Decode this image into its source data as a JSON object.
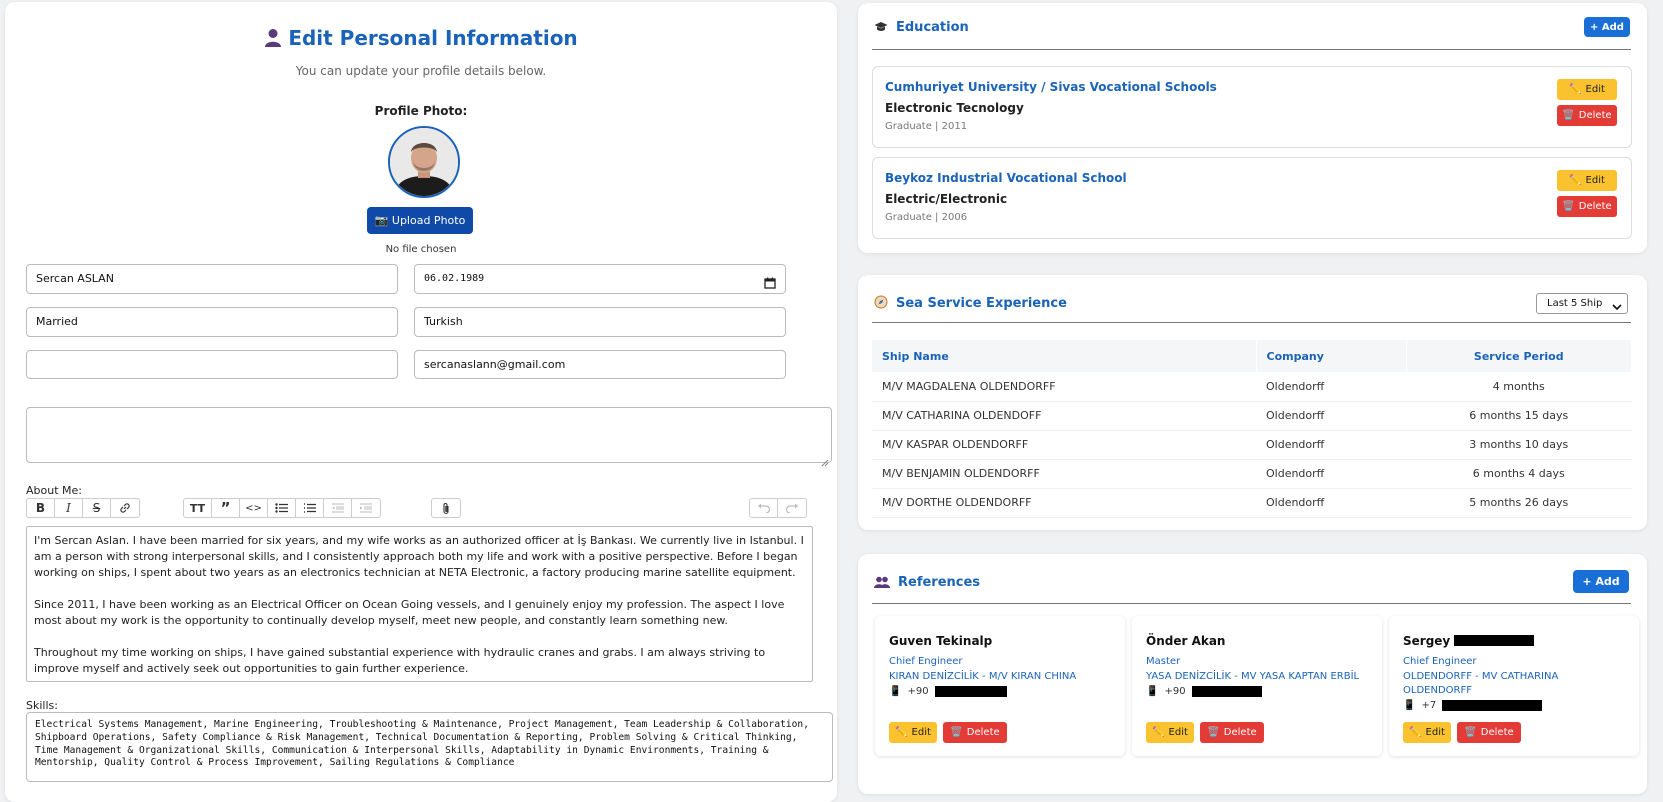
{
  "profile": {
    "title": "Edit Personal Information",
    "subtitle": "You can update your profile details below.",
    "photo_label": "Profile Photo:",
    "upload_label": "Upload Photo",
    "no_file": "No file chosen",
    "full_name": "Sercan ASLAN",
    "birth_date": "06.02.1989",
    "marital_status": "Married",
    "nationality": "Turkish",
    "phone": "",
    "email": "sercanaslann@gmail.com",
    "address": "",
    "about_label": "About Me:",
    "about_paragraphs": [
      "I'm Sercan Aslan. I have been married for six years, and my wife works as an authorized officer at İş Bankası. We currently live in Istanbul. I am a person with strong interpersonal skills, and I consistently approach both my life and work with a positive perspective. Before I began working on ships, I spent about two years as an electronics technician at NETA Electronic, a factory producing marine satellite equipment.",
      "Since 2011, I have been working as an Electrical Officer on Ocean Going vessels, and I genuinely enjoy my profession. The aspect I love most about my work is the opportunity to continually develop myself, meet new people, and constantly learn something new.",
      "Throughout my time working on ships, I have gained substantial experience with hydraulic cranes and grabs. I am always striving to improve myself and actively seek out opportunities to gain further experience."
    ],
    "skills_label": "Skills:",
    "skills": "Electrical Systems Management, Marine Engineering, Troubleshooting & Maintenance, Project Management, Team Leadership & Collaboration, Shipboard Operations, Safety Compliance & Risk Management, Technical Documentation & Reporting, Problem Solving & Critical Thinking, Time Management & Organizational Skills, Communication & Interpersonal Skills, Adaptability in Dynamic Environments, Training & Mentorship, Quality Control & Process Improvement, Sailing Regulations & Compliance"
  },
  "education": {
    "title": "Education",
    "add_label": "+ Add",
    "edit_label": "Edit",
    "delete_label": "Delete",
    "items": [
      {
        "school": "Cumhuriyet University / Sivas Vocational Schools",
        "department": "Electronic Tecnology",
        "meta": "Graduate | 2011"
      },
      {
        "school": "Beykoz Industrial Vocational School",
        "department": "Electric/Electronic",
        "meta": "Graduate | 2006"
      }
    ]
  },
  "sea_service": {
    "title": "Sea Service Experience",
    "filter_value": "Last 5 Ship",
    "columns": [
      "Ship Name",
      "Company",
      "Service Period"
    ],
    "rows": [
      {
        "ship": "M/V MAGDALENA OLDENDORFF",
        "company": "Oldendorff",
        "period": "4 months"
      },
      {
        "ship": "M/V CATHARINA OLDENDOFF",
        "company": "Oldendorff",
        "period": "6 months 15 days"
      },
      {
        "ship": "M/V KASPAR OLDENDORFF",
        "company": "Oldendorff",
        "period": "3 months 10 days"
      },
      {
        "ship": "M/V BENJAMIN OLDENDORFF",
        "company": "Oldendorff",
        "period": "6 months 4 days"
      },
      {
        "ship": "M/V DORTHE OLDENDORFF",
        "company": "Oldendorff",
        "period": "5 months 26 days"
      }
    ]
  },
  "references": {
    "title": "References",
    "add_label": "+ Add",
    "edit_label": "Edit",
    "delete_label": "Delete",
    "items": [
      {
        "name": "Guven Tekinalp",
        "title": "Chief Engineer",
        "company": "KIRAN DENİZCİLİK - M/V KIRAN CHINA",
        "phone": "+90"
      },
      {
        "name": "Önder Akan",
        "title": "Master",
        "company": "YASA DENİZCİLİK - MV YASA KAPTAN ERBİL",
        "phone": "+90"
      },
      {
        "name": "Sergey",
        "title": "Chief Engineer",
        "company": "OLDENDORFF - MV CATHARINA OLDENDORFF",
        "phone": "+7"
      }
    ]
  },
  "colors": {
    "accent": "#1a63b8",
    "edit": "#f9c22e",
    "delete": "#e33b36",
    "upload": "#0f4aa8"
  }
}
